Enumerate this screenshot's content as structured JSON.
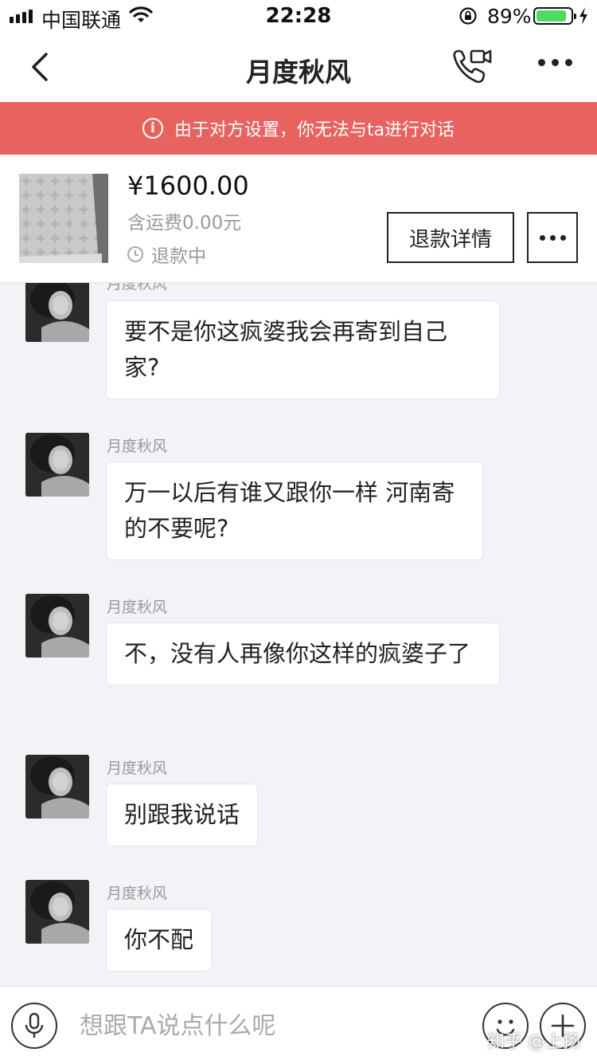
{
  "status_bar": {
    "carrier": "中国联通",
    "time": "22:28",
    "battery": "89%",
    "battery_level": 0.89,
    "icons": [
      "signal-icon",
      "wifi-icon",
      "orientation-lock-icon",
      "battery-icon",
      "charging-icon"
    ]
  },
  "nav": {
    "title": "月度秋风",
    "icons": [
      "back-arrow-icon",
      "video-call-icon",
      "more-icon"
    ]
  },
  "banner": {
    "text": "由于对方设置，你无法与ta进行对话",
    "icon": "info-icon",
    "color": "#e8625f"
  },
  "product": {
    "price": "¥1600.00",
    "shipping": "含运费0.00元",
    "status": "退款中",
    "refund_button": "退款详情"
  },
  "messages": [
    {
      "sender": "月度秋风",
      "text": "要不是你这疯婆我会再寄到自己家?"
    },
    {
      "sender": "月度秋风",
      "text": "万一以后有谁又跟你一样 河南寄的不要呢?"
    },
    {
      "sender": "月度秋风",
      "text": "不，没有人再像你这样的疯婆子了"
    },
    {
      "sender": "月度秋风",
      "text": "别跟我说话"
    },
    {
      "sender": "月度秋风",
      "text": "你不配"
    }
  ],
  "input": {
    "placeholder": "想跟TA说点什么呢",
    "icons": [
      "microphone-icon",
      "emoji-icon",
      "plus-icon"
    ]
  },
  "watermark": "知乎 @上扬"
}
